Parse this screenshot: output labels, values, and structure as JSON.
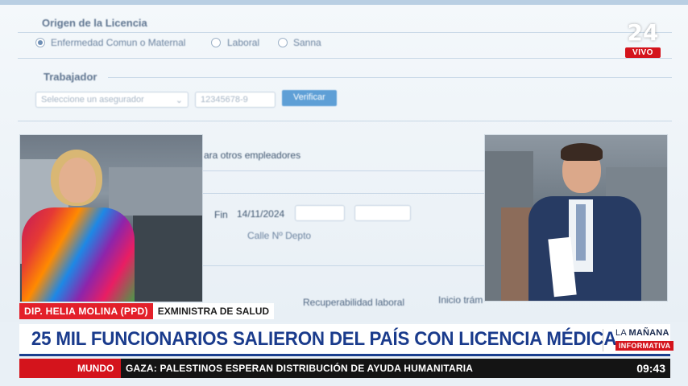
{
  "background_form": {
    "section_origin": "Origen de la Licencia",
    "radio_options": [
      "Enfermedad Comun o Maternal",
      "Laboral",
      "Sanna"
    ],
    "section_worker": "Trabajador",
    "select_placeholder": "Seleccione un asegurador",
    "rut_placeholder": "12345678-9",
    "verify_button": "Verificar",
    "other_employers": "ara otros empleadores",
    "fin_label": "Fin",
    "fin_value": "14/11/2024",
    "address_labels": "Calle  Nº  Depto",
    "recovery": "Recuperabilidad laboral",
    "start_procedure": "Inicio trám"
  },
  "channel": {
    "logo_number": "24",
    "live_label": "VIVO"
  },
  "lower_third": {
    "guest_name": "DIP. HELIA MOLINA (PPD)",
    "guest_role": "EXMINISTRA DE SALUD"
  },
  "headline": {
    "text": "25 MIL FUNCIONARIOS SALIERON DEL PAÍS CON LICENCIA MÉDICA"
  },
  "program": {
    "brand_prefix": "LA",
    "brand_name": "MAÑANA",
    "brand_tag": "INFORMATIVA"
  },
  "ticker": {
    "section": "MUNDO",
    "news": "GAZA: PALESTINOS ESPERAN DISTRIBUCIÓN DE AYUDA HUMANITARIA",
    "time": "09:43"
  },
  "colors": {
    "accent_red": "#d4141c",
    "headline_blue": "#1a3b8c",
    "ticker_bg": "#141414"
  }
}
